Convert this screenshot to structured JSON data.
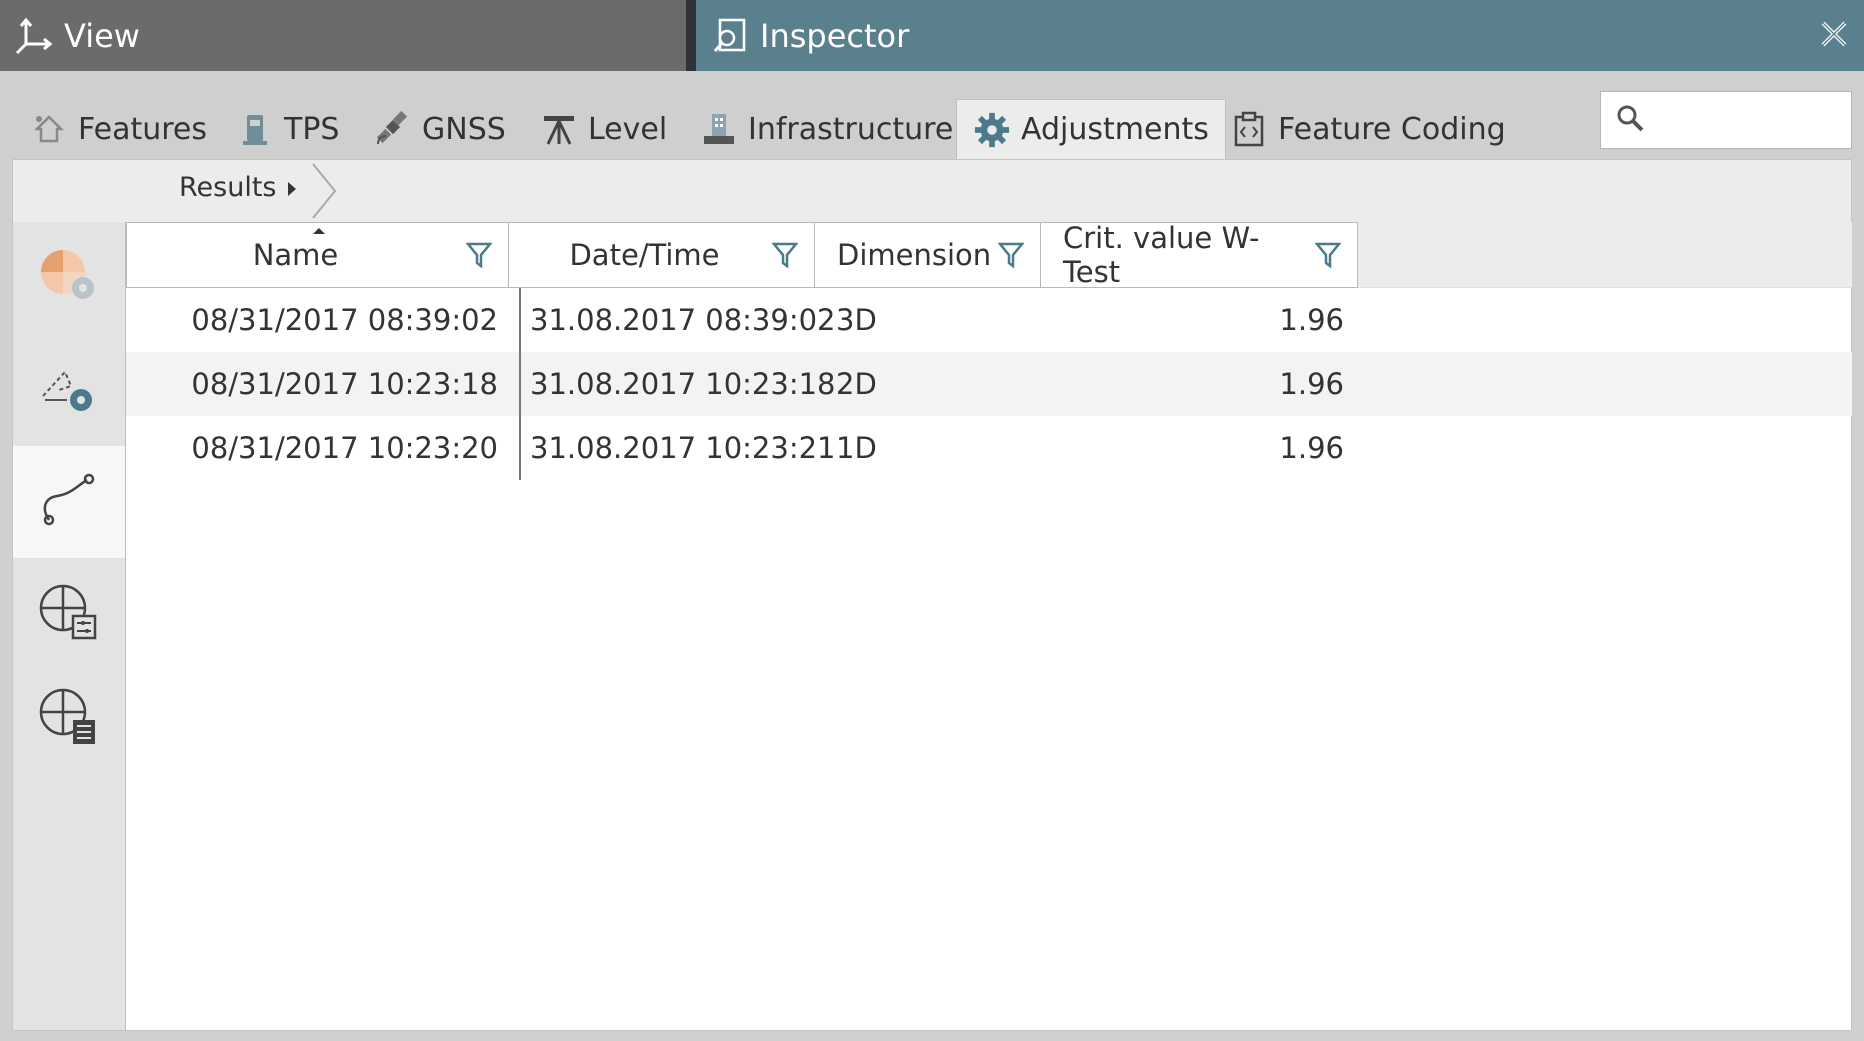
{
  "titlebar": {
    "view_title": "View",
    "inspector_title": "Inspector"
  },
  "tabs": [
    {
      "label": "Features",
      "icon": "features-icon"
    },
    {
      "label": "TPS",
      "icon": "tps-icon"
    },
    {
      "label": "GNSS",
      "icon": "satellite-icon"
    },
    {
      "label": "Level",
      "icon": "level-icon"
    },
    {
      "label": "Infrastructure",
      "icon": "infrastructure-icon"
    },
    {
      "label": "Adjustments",
      "icon": "gear-icon",
      "active": true
    },
    {
      "label": "Feature Coding",
      "icon": "feature-coding-icon"
    }
  ],
  "search": {
    "placeholder": ""
  },
  "breadcrumb": {
    "label": "Results"
  },
  "sidebar": {
    "items": [
      {
        "icon": "adjustment-pie-gear-icon"
      },
      {
        "icon": "network-gear-icon"
      },
      {
        "icon": "trajectory-icon",
        "active": true
      },
      {
        "icon": "globe-settings-icon"
      },
      {
        "icon": "globe-report-icon"
      }
    ]
  },
  "table": {
    "columns": [
      "Name",
      "Date/Time",
      "Dimension",
      "Crit. value W-Test"
    ],
    "rows": [
      [
        "08/31/2017 08:39:02",
        "31.08.2017 08:39:02",
        "3D",
        "1.96"
      ],
      [
        "08/31/2017 10:23:18",
        "31.08.2017 10:23:18",
        "2D",
        "1.96"
      ],
      [
        "08/31/2017 10:23:20",
        "31.08.2017 10:23:21",
        "1D",
        "1.96"
      ]
    ]
  },
  "colors": {
    "inspector_bar": "#5b808d",
    "view_bar": "#6b6b6b",
    "accent": "#4a7a8c"
  }
}
